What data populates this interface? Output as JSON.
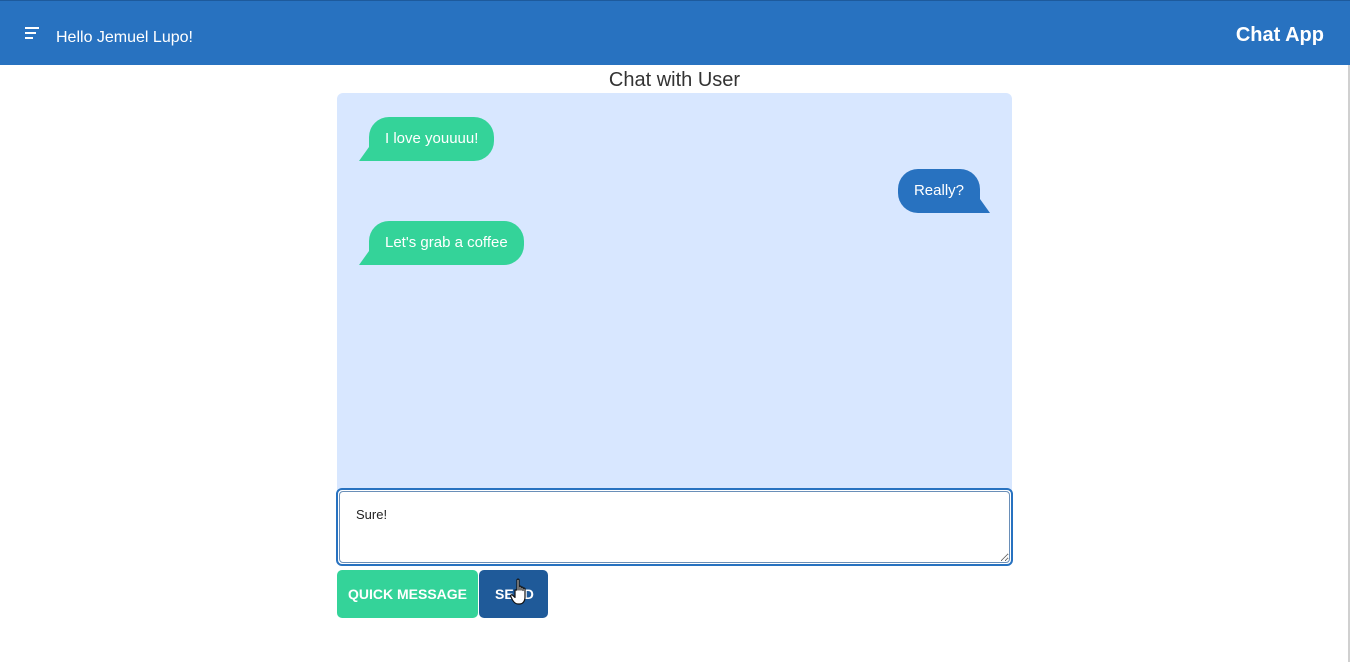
{
  "header": {
    "menu_icon": "hamburger-menu-icon",
    "greeting": "Hello Jemuel Lupo!",
    "app_title": "Chat App",
    "background_color": "#2872c0"
  },
  "chat": {
    "title": "Chat with User",
    "messages": [
      {
        "text": "I love youuuu!",
        "side": "left"
      },
      {
        "text": "Really?",
        "side": "right"
      },
      {
        "text": "Let's grab a coffee",
        "side": "left"
      }
    ],
    "incoming_color": "#34d399",
    "outgoing_color": "#2872c0",
    "panel_color": "#d8e7ff"
  },
  "composer": {
    "value": "Sure!",
    "quick_message_label": "QUICK MESSAGE",
    "send_label": "SEND"
  }
}
